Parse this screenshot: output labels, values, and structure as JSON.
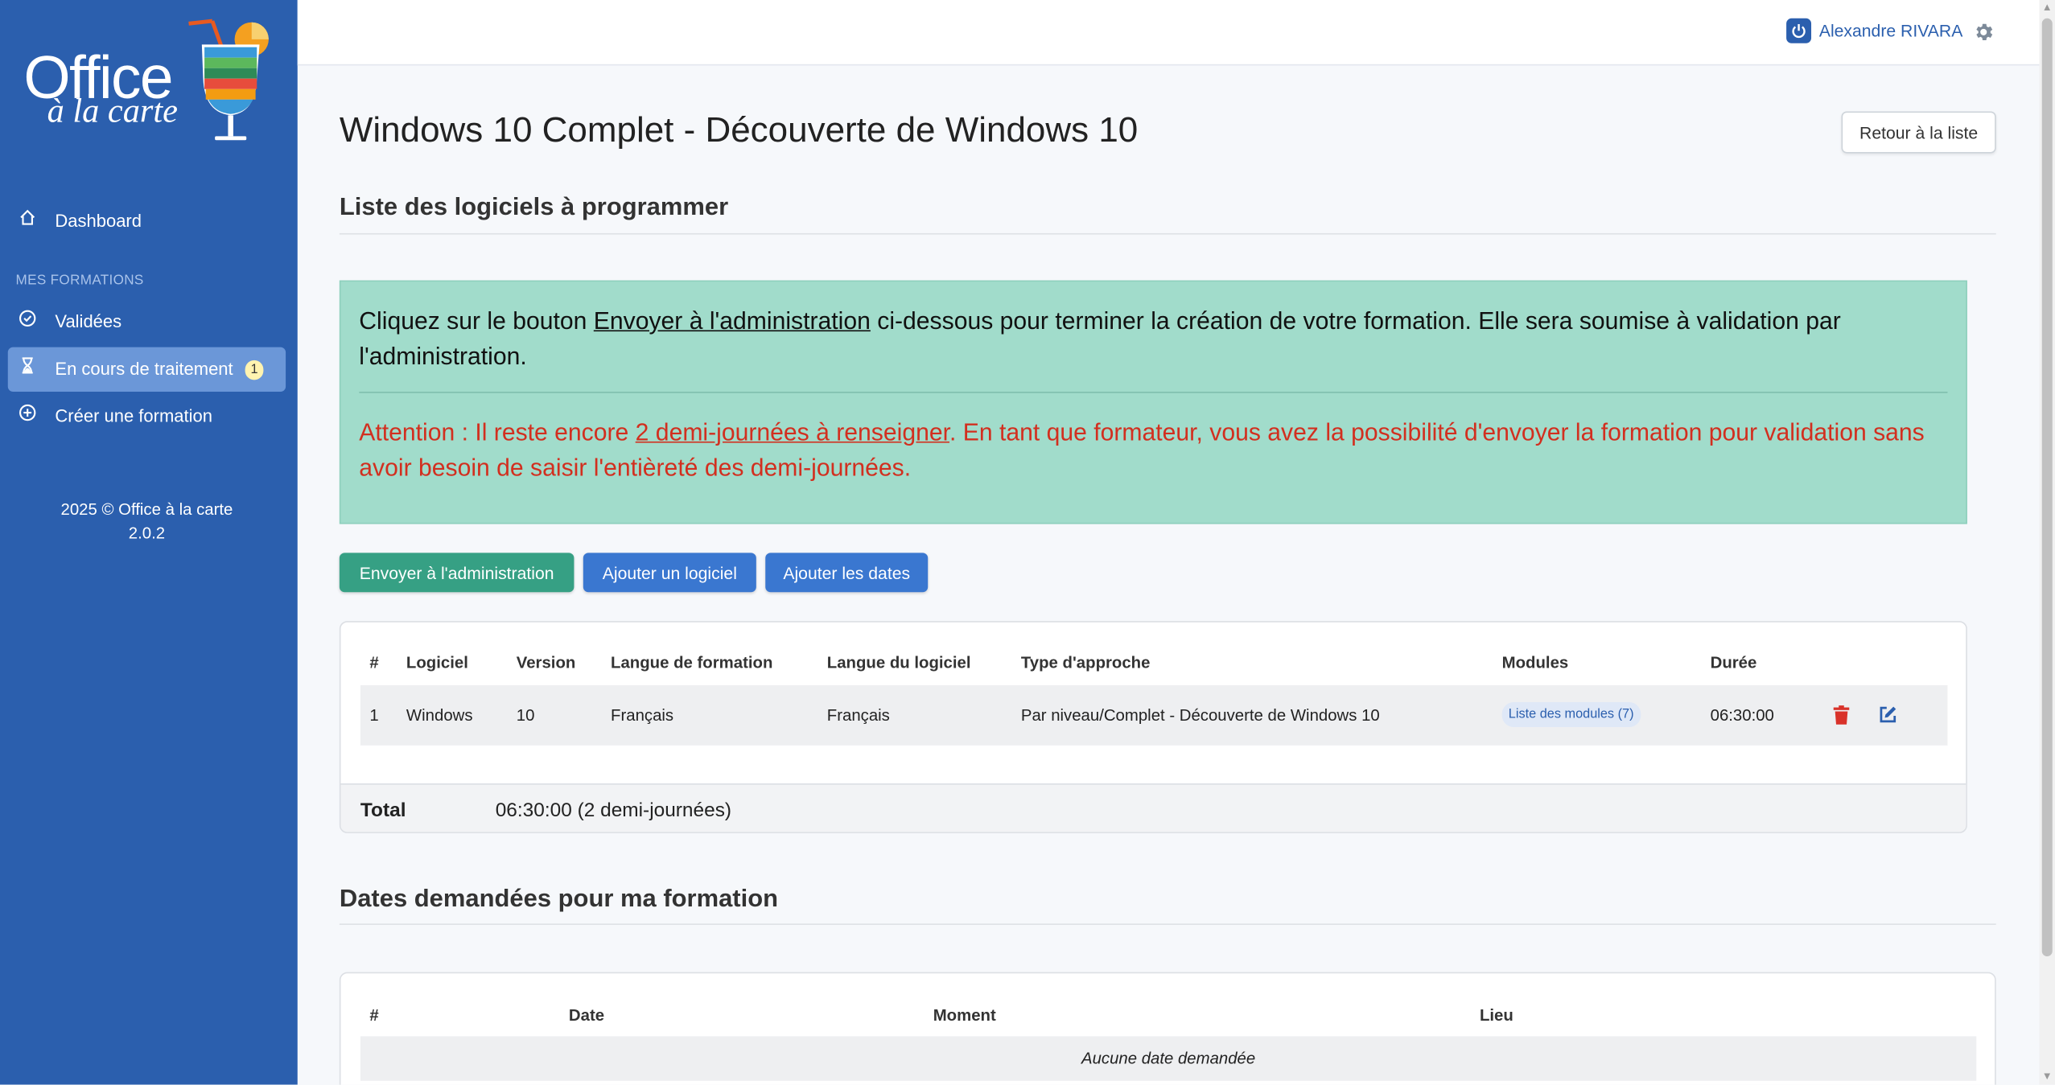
{
  "brand": {
    "name_line1": "Office",
    "name_line2": "à la carte"
  },
  "sidebar": {
    "dashboard": "Dashboard",
    "section": "MES FORMATIONS",
    "items": [
      {
        "label": "Validées",
        "icon": "check-circle-icon"
      },
      {
        "label": "En cours de traitement",
        "icon": "hourglass-icon",
        "badge": "1",
        "active": true
      },
      {
        "label": "Créer une formation",
        "icon": "plus-circle-icon"
      }
    ],
    "footer_line1": "2025 © Office à la carte",
    "footer_line2": "2.0.2"
  },
  "topbar": {
    "user": "Alexandre RIVARA"
  },
  "page": {
    "title": "Windows 10 Complet - Découverte de Windows 10",
    "back_button": "Retour à la liste",
    "section1": "Liste des logiciels à programmer",
    "section2": "Dates demandées pour ma formation"
  },
  "alert": {
    "p1_before": "Cliquez sur le bouton ",
    "p1_link": "Envoyer à l'administration",
    "p1_after": " ci-dessous pour terminer la création de votre formation. Elle sera soumise à validation par l'administration.",
    "p2_before": "Attention : Il reste encore ",
    "p2_link": "2 demi-journées à renseigner",
    "p2_after": ". En tant que formateur, vous avez la possibilité d'envoyer la formation pour validation sans avoir besoin de saisir l'entièreté des demi-journées."
  },
  "actions": {
    "send": "Envoyer à l'administration",
    "add_software": "Ajouter un logiciel",
    "add_dates": "Ajouter les dates"
  },
  "software_table": {
    "headers": [
      "#",
      "Logiciel",
      "Version",
      "Langue de formation",
      "Langue du logiciel",
      "Type d'approche",
      "Modules",
      "Durée"
    ],
    "rows": [
      {
        "num": "1",
        "software": "Windows",
        "version": "10",
        "training_lang": "Français",
        "software_lang": "Français",
        "approach": "Par niveau/Complet - Découverte de Windows 10",
        "modules": "Liste des modules (7)",
        "duration": "06:30:00"
      }
    ],
    "total_label": "Total",
    "total_value": "06:30:00 (2 demi-journées)"
  },
  "dates_table": {
    "headers": [
      "#",
      "Date",
      "Moment",
      "Lieu"
    ],
    "empty": "Aucune date demandée"
  },
  "colors": {
    "sidebar": "#2b5fae",
    "success": "#36a084",
    "primary": "#3a77d0",
    "alert_bg": "#a1dccb",
    "danger_text": "#d22f1f"
  }
}
